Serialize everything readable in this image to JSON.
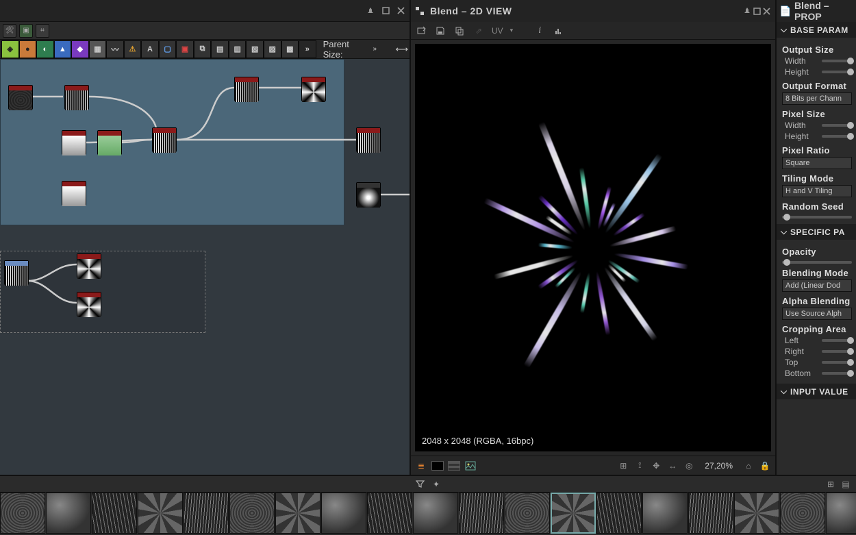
{
  "viewer": {
    "title": "Blend – 2D VIEW",
    "uv_label": "UV",
    "info": "2048 x 2048 (RGBA, 16bpc)",
    "zoom": "27,20%"
  },
  "props": {
    "title": "Blend – PROP",
    "sections": {
      "base": "BASE PARAM",
      "specific": "SPECIFIC PA",
      "input": "INPUT VALUE"
    },
    "output_size": {
      "label": "Output Size",
      "width": "Width",
      "height": "Height"
    },
    "output_format": {
      "label": "Output Format",
      "value": "8 Bits per Chann"
    },
    "pixel_size": {
      "label": "Pixel Size",
      "width": "Width",
      "height": "Height"
    },
    "pixel_ratio": {
      "label": "Pixel Ratio",
      "value": "Square"
    },
    "tiling_mode": {
      "label": "Tiling Mode",
      "value": "H and V Tiling"
    },
    "random_seed": {
      "label": "Random Seed"
    },
    "opacity": {
      "label": "Opacity"
    },
    "blending_mode": {
      "label": "Blending Mode",
      "value": "Add (Linear Dod"
    },
    "alpha_blending": {
      "label": "Alpha Blending",
      "value": "Use Source Alph"
    },
    "cropping": {
      "label": "Cropping Area",
      "left": "Left",
      "right": "Right",
      "top": "Top",
      "bottom": "Bottom"
    }
  },
  "graph_toolbar": {
    "parent_size_label": "Parent Size:"
  },
  "node_buttons": [
    {
      "bg": "#8ac23f",
      "fg": "#222",
      "glyph": "◈"
    },
    {
      "bg": "#c97a3a",
      "fg": "#222",
      "glyph": "●"
    },
    {
      "bg": "#2e7d4f",
      "fg": "#fff",
      "glyph": "◐"
    },
    {
      "bg": "#3a6bbf",
      "fg": "#fff",
      "glyph": "▲"
    },
    {
      "bg": "#7a3abf",
      "fg": "#fff",
      "glyph": "◆"
    },
    {
      "bg": "#555",
      "fg": "#ccc",
      "glyph": "▦"
    },
    {
      "bg": "#333",
      "fg": "#ccc",
      "glyph": "〰"
    },
    {
      "bg": "#333",
      "fg": "#e0a030",
      "glyph": "⚠"
    },
    {
      "bg": "#333",
      "fg": "#ccc",
      "glyph": "A"
    },
    {
      "bg": "#333",
      "fg": "#6af",
      "glyph": "▢"
    },
    {
      "bg": "#333",
      "fg": "#d44",
      "glyph": "▣"
    },
    {
      "bg": "#333",
      "fg": "#ccc",
      "glyph": "⧉"
    },
    {
      "bg": "#333",
      "fg": "#ccc",
      "glyph": "▤"
    },
    {
      "bg": "#333",
      "fg": "#ccc",
      "glyph": "▥"
    },
    {
      "bg": "#333",
      "fg": "#ccc",
      "glyph": "▧"
    },
    {
      "bg": "#333",
      "fg": "#ccc",
      "glyph": "▨"
    },
    {
      "bg": "#333",
      "fg": "#ccc",
      "glyph": "▩"
    },
    {
      "bg": "#262626",
      "fg": "#ccc",
      "glyph": "»"
    }
  ],
  "shards": [
    {
      "ang": 10,
      "len": 110,
      "col": "#b89eff"
    },
    {
      "ang": 35,
      "len": 55,
      "col": "#6ad7c8"
    },
    {
      "ang": 55,
      "len": 130,
      "col": "#e8e8ff"
    },
    {
      "ang": 80,
      "len": 95,
      "col": "#a060e8"
    },
    {
      "ang": 100,
      "len": 60,
      "col": "#5fe0c0"
    },
    {
      "ang": 120,
      "len": 160,
      "col": "#dcd0ff"
    },
    {
      "ang": 145,
      "len": 70,
      "col": "#8e55e0"
    },
    {
      "ang": 165,
      "len": 120,
      "col": "#fff"
    },
    {
      "ang": 185,
      "len": 50,
      "col": "#5fc8e0"
    },
    {
      "ang": 205,
      "len": 145,
      "col": "#c8a8ff"
    },
    {
      "ang": 225,
      "len": 80,
      "col": "#7a3ae0"
    },
    {
      "ang": 248,
      "len": 170,
      "col": "#f0e8ff"
    },
    {
      "ang": 262,
      "len": 90,
      "col": "#60e0b8"
    },
    {
      "ang": 285,
      "len": 65,
      "col": "#b060ff"
    },
    {
      "ang": 305,
      "len": 140,
      "col": "#a8d8ff"
    },
    {
      "ang": 325,
      "len": 55,
      "col": "#8e55e0"
    },
    {
      "ang": 345,
      "len": 100,
      "col": "#e8d8ff"
    },
    {
      "ang": 45,
      "len": 35,
      "col": "#fff"
    },
    {
      "ang": 135,
      "len": 40,
      "col": "#6ad7c8"
    },
    {
      "ang": 215,
      "len": 45,
      "col": "#fff"
    },
    {
      "ang": 295,
      "len": 38,
      "col": "#b89eff"
    }
  ],
  "thumb_classes": [
    "t-noise",
    "t-cloud",
    "t-scratch",
    "t-cell",
    "t-scratch2",
    "t-noise",
    "t-cell",
    "t-cloud",
    "t-scratch",
    "t-cloud",
    "t-scratch2",
    "t-noise",
    "t-cell sel",
    "t-scratch",
    "t-cloud",
    "t-scratch2",
    "t-cell",
    "t-noise",
    "t-cloud"
  ]
}
